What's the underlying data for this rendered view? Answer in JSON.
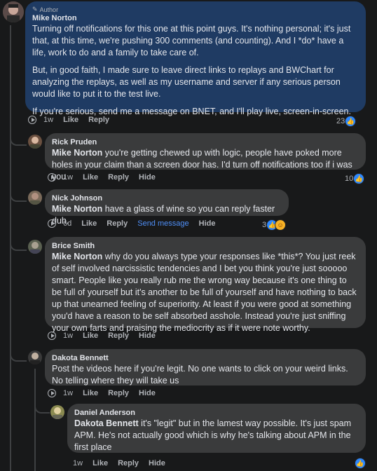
{
  "comments": [
    {
      "author_badge": "Author",
      "name": "Mike Norton",
      "paragraphs": [
        "Turning off notifications for this one at this point guys. It's nothing personal; it's just that, at this time, we're pushing 300 comments (and counting). And I *do* have a life, work to do and a family to take care of.",
        "But, in good faith, I made sure to leave direct links to replays and BWChart for analyzing the replays, as well as my username and server if any serious person would like to put it to the test live.",
        "If you're serious, send me a message on BNET, and I'll play live, screen-in-screen."
      ],
      "time": "1w",
      "like": "Like",
      "reply": "Reply",
      "reaction_count": "23"
    },
    {
      "name": "Rick Pruden",
      "mention": "Mike Norton",
      "text": " you're getting chewed up with logic, people have poked more holes in your claim than a screen door has. I'd turn off notifications too if i was you",
      "time": "1w",
      "like": "Like",
      "reply": "Reply",
      "hide": "Hide",
      "reaction_count": "10"
    },
    {
      "name": "Nick Johnson",
      "mention": "Mike Norton",
      "text": " have a glass of wine so you can reply faster duh.",
      "time": "6d",
      "like": "Like",
      "reply": "Reply",
      "send_message": "Send message",
      "hide": "Hide",
      "reaction_count": "3"
    },
    {
      "name": "Brice Smith",
      "mention": "Mike Norton",
      "text": " why do you always type your responses like *this*? You just reek of self involved narcissistic tendencies and I bet you think you're just sooooo smart. People like you really rub me the wrong way because it's one thing to be full of yourself but it's another to be full of yourself and have nothing to back up that unearned feeling of superiority. At least if you were good at something you'd have a reason to be self absorbed asshole. Instead you're just sniffing your own farts and praising the mediocrity as if it were note worthy.",
      "time": "1w",
      "like": "Like",
      "reply": "Reply",
      "hide": "Hide"
    },
    {
      "name": "Dakota Bennett",
      "text": "Post the videos here if you're legit. No one wants to click on your weird links. No telling where they will take us",
      "time": "1w",
      "like": "Like",
      "reply": "Reply",
      "hide": "Hide"
    },
    {
      "name": "Daniel Anderson",
      "mention": "Dakota Bennett",
      "text": " it's \"legit\" but in the lamest way possible. It's just spam APM. He's not actually good which is why he's talking about APM in the first place",
      "time": "1w",
      "like": "Like",
      "reply": "Reply",
      "hide": "Hide"
    }
  ],
  "colors": {
    "background": "#18191a",
    "bubble": "#3a3b3c",
    "author_bubble": "#1f3b63",
    "link": "#4f8ff7",
    "like_blue": "#2d88ff"
  }
}
